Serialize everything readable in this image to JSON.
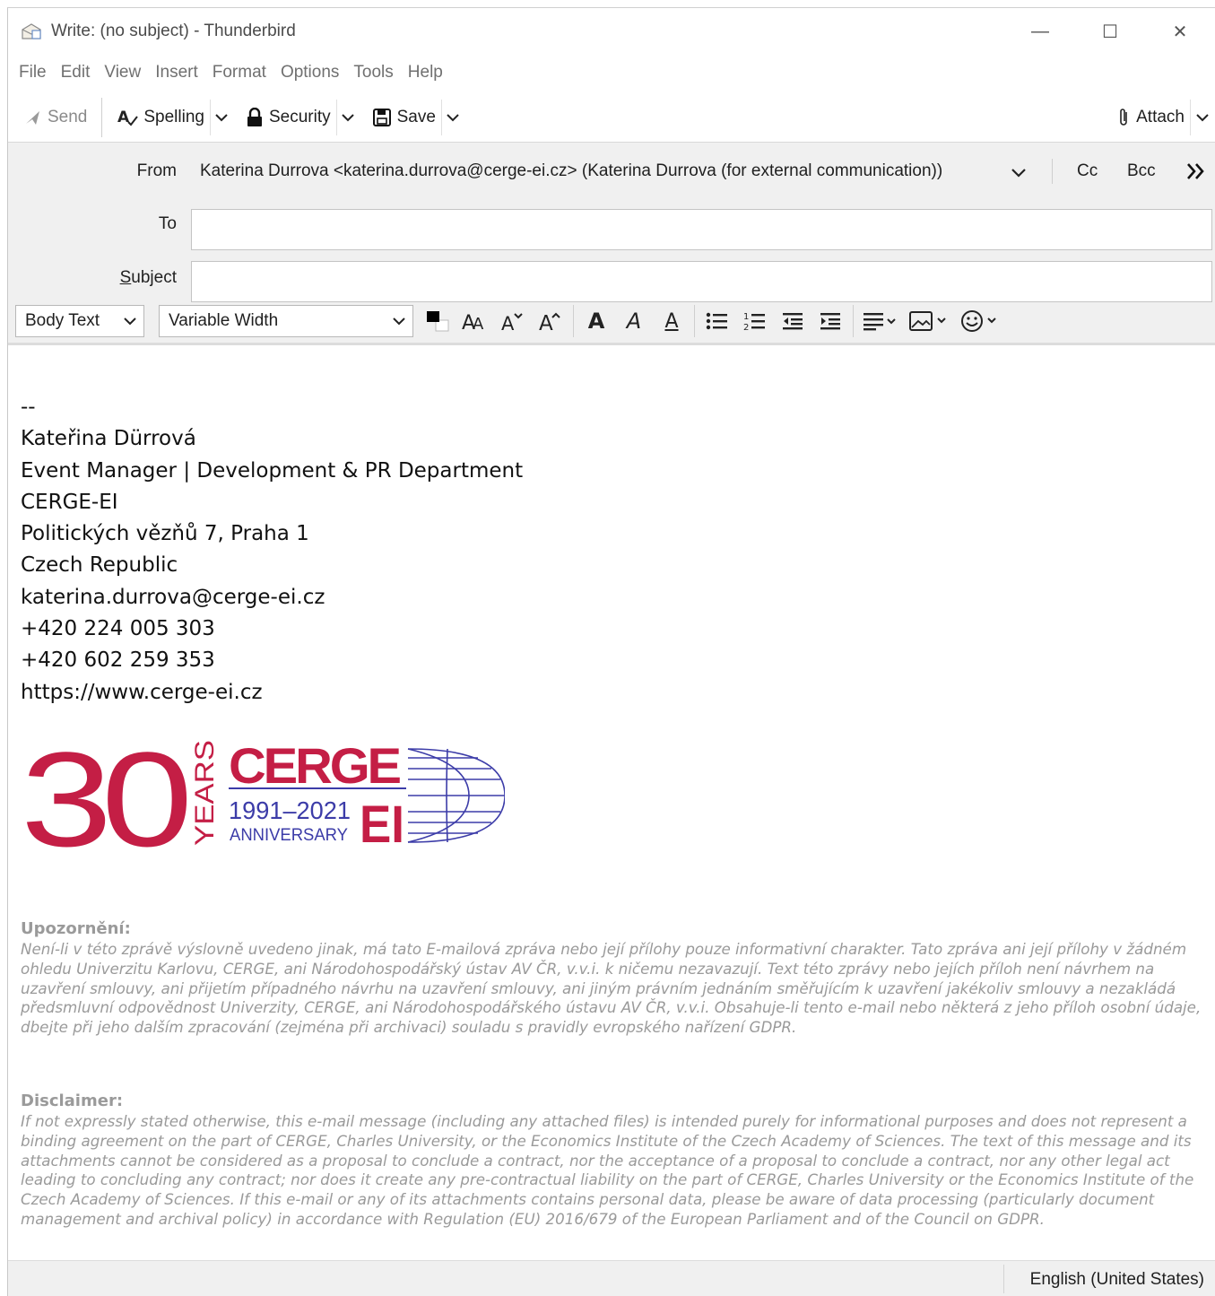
{
  "window": {
    "title": "Write: (no subject) - Thunderbird",
    "minimize": "—",
    "maximize": "☐",
    "close": "✕"
  },
  "menu": [
    "File",
    "Edit",
    "View",
    "Insert",
    "Format",
    "Options",
    "Tools",
    "Help"
  ],
  "toolbar": {
    "send": "Send",
    "spelling": "Spelling",
    "security": "Security",
    "save": "Save",
    "attach": "Attach"
  },
  "headers": {
    "from_label": "From",
    "from_value": "Katerina Durrova <katerina.durrova@cerge-ei.cz> (Katerina Durrova (for external communication))",
    "cc": "Cc",
    "bcc": "Bcc",
    "to_label": "To",
    "to_value": "",
    "subject_label": "Subject",
    "subject_value": ""
  },
  "format": {
    "paragraph_style": "Body Text",
    "font": "Variable Width"
  },
  "signature": [
    "--",
    "Kateřina Dürrová",
    "Event Manager | Development & PR Department",
    "CERGE-EI",
    "Politických vězňů 7, Praha 1",
    "Czech Republic",
    "katerina.durrova@cerge-ei.cz",
    "+420 224 005 303",
    "+420 602 259 353",
    "https://www.cerge-ei.cz"
  ],
  "logo": {
    "number": "30",
    "years": "YEARS",
    "brand": "CERGE",
    "dates": "1991–2021",
    "anniversary": "ANNIVERSARY",
    "ei": "EI",
    "red": "#c41e45",
    "blue": "#3c3ca8"
  },
  "notice_cz": {
    "heading": "Upozornění:",
    "text": "Není-li v této zprávě výslovně uvedeno jinak, má tato E-mailová zpráva nebo její přílohy pouze informativní charakter. Tato zpráva ani její přílohy v žádném ohledu Univerzitu Karlovu, CERGE, ani Národohospodářský ústav AV ČR, v.v.i. k ničemu nezavazují. Text této zprávy nebo jejích příloh není návrhem na uzavření smlouvy, ani přijetím případného návrhu na uzavření smlouvy, ani jiným právním jednáním směřujícím k uzavření jakékoliv smlouvy a nezakládá předsmluvní odpovědnost Univerzity, CERGE, ani Národohospodářského ústavu AV ČR, v.v.i. Obsahuje-li tento e-mail nebo některá z jeho příloh osobní údaje, dbejte při jeho dalším zpracování (zejména při archivaci) souladu s pravidly evropského nařízení GDPR."
  },
  "notice_en": {
    "heading": "Disclaimer:",
    "text": "If not expressly stated otherwise, this e-mail message (including any attached files) is intended purely for informational purposes and does not represent a binding agreement on the part of CERGE, Charles University, or the Economics Institute of the Czech Academy of Sciences. The text of this message and its attachments cannot be considered as a proposal to conclude a contract, nor the acceptance of a proposal to conclude a contract, nor any other legal act leading to concluding any contract; nor does it create any pre-contractual liability on the part of CERGE, Charles University or the Economics Institute of the Czech Academy of Sciences. If this e-mail or any of its attachments contains personal data, please be aware of data processing (particularly document management and archival policy) in accordance with Regulation (EU) 2016/679 of the European Parliament and of the Council on GDPR."
  },
  "status": {
    "language": "English (United States)"
  }
}
